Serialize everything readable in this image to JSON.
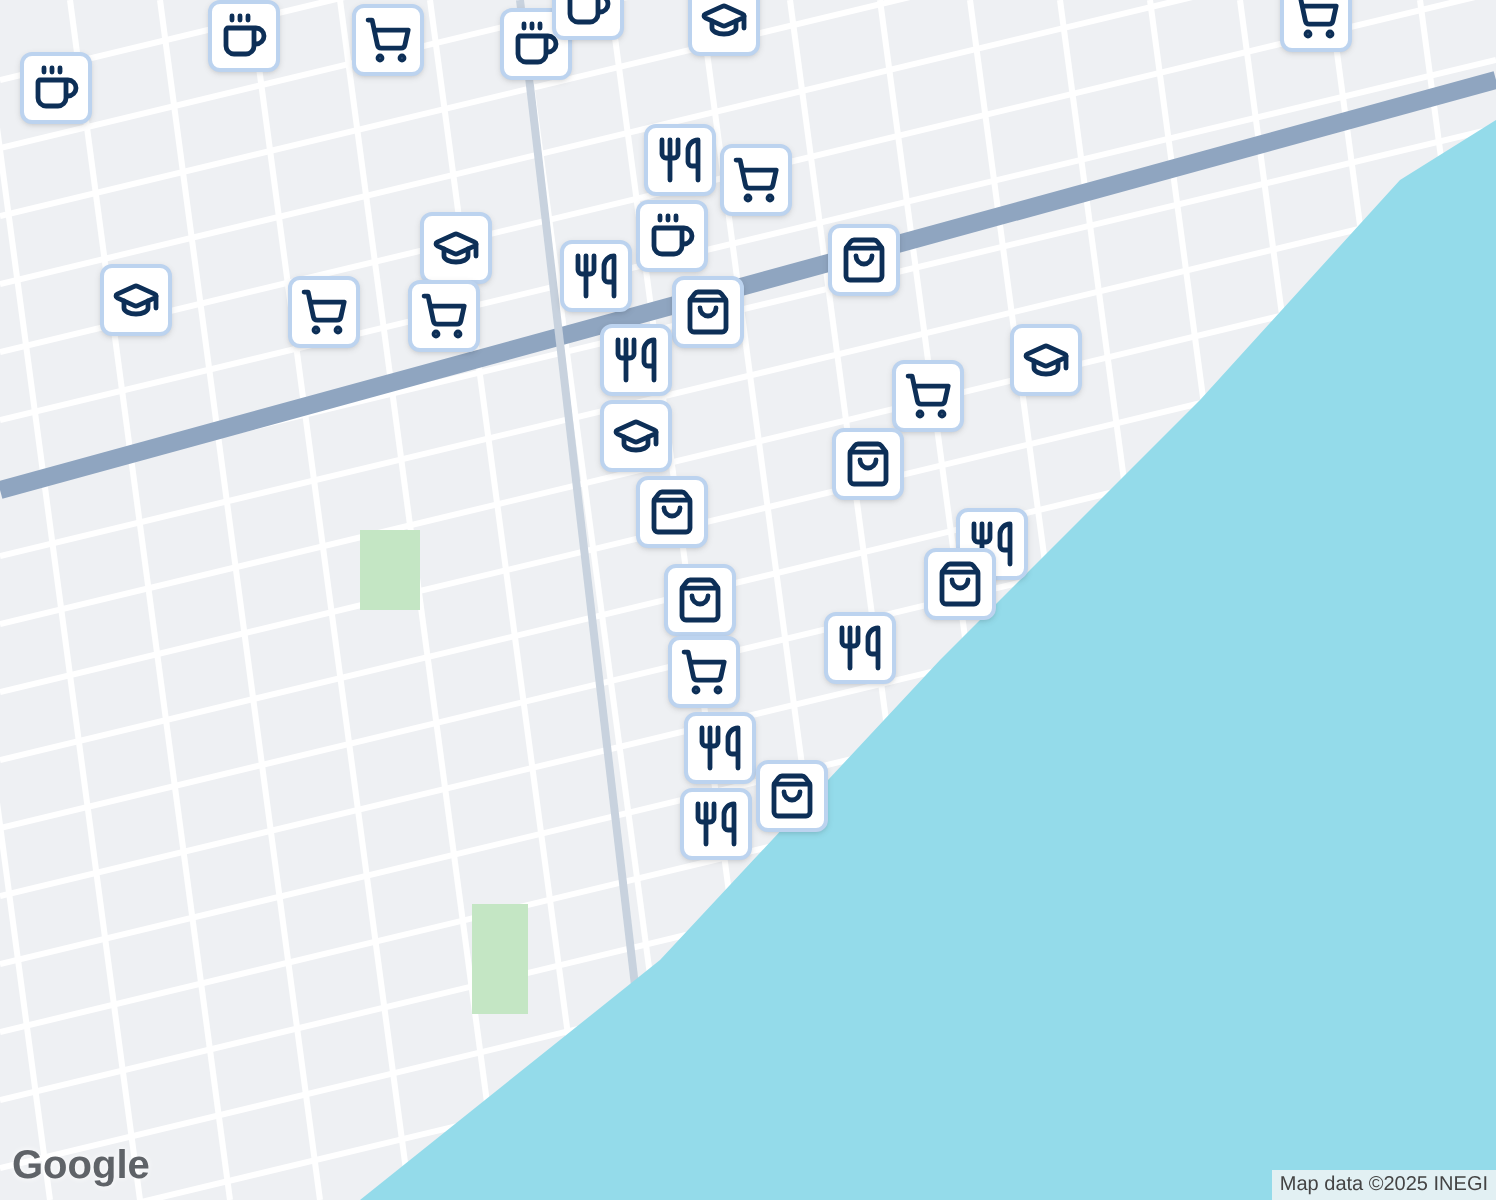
{
  "map": {
    "markers": [
      {
        "kind": "cafe"
      },
      {
        "kind": "shop"
      },
      {
        "kind": "cafe"
      },
      {
        "kind": "cafe"
      },
      {
        "kind": "school"
      },
      {
        "kind": "shop"
      },
      {
        "kind": "cafe"
      },
      {
        "kind": "shop"
      },
      {
        "kind": "restaurant"
      },
      {
        "kind": "cafe"
      },
      {
        "kind": "school"
      },
      {
        "kind": "store"
      },
      {
        "kind": "store"
      },
      {
        "kind": "school"
      },
      {
        "kind": "shop"
      },
      {
        "kind": "restaurant"
      },
      {
        "kind": "shop"
      },
      {
        "kind": "restaurant"
      },
      {
        "kind": "school"
      },
      {
        "kind": "school"
      },
      {
        "kind": "shop"
      },
      {
        "kind": "store"
      },
      {
        "kind": "store"
      },
      {
        "kind": "restaurant"
      },
      {
        "kind": "store"
      },
      {
        "kind": "store"
      },
      {
        "kind": "restaurant"
      },
      {
        "kind": "shop"
      },
      {
        "kind": "restaurant"
      },
      {
        "kind": "restaurant"
      },
      {
        "kind": "store"
      }
    ]
  },
  "logo": "Google",
  "attribution": "Map data ©2025 INEGI"
}
